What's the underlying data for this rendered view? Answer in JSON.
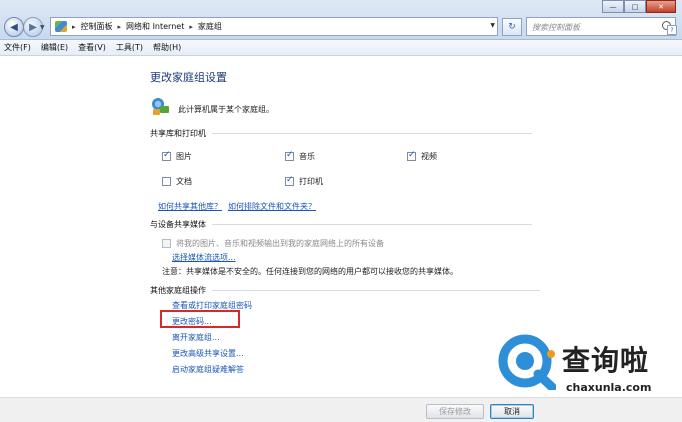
{
  "address": {
    "crumbs": [
      "控制面板",
      "网络和 Internet",
      "家庭组"
    ],
    "search_placeholder": "搜索控制面板"
  },
  "window": {
    "minimize": "—",
    "maximize": "□",
    "close": "✕"
  },
  "menubar": [
    "文件(F)",
    "编辑(E)",
    "查看(V)",
    "工具(T)",
    "帮助(H)"
  ],
  "page": {
    "title": "更改家庭组设置",
    "status": "此计算机属于某个家庭组。"
  },
  "share": {
    "heading": "共享库和打印机",
    "items": [
      {
        "label": "图片",
        "checked": true
      },
      {
        "label": "音乐",
        "checked": true
      },
      {
        "label": "视频",
        "checked": true
      },
      {
        "label": "文档",
        "checked": false
      },
      {
        "label": "打印机",
        "checked": true
      }
    ],
    "link_other_libs": "如何共享其他库？",
    "link_exclude": "如何排除文件和文件夹？"
  },
  "media": {
    "heading": "与设备共享媒体",
    "stream_label": "将我的图片、音乐和视频输出到我的家庭网络上的所有设备",
    "stream_options_link": "选择媒体流选项...",
    "note": "注意：共享媒体是不安全的。任何连接到您的网络的用户都可以接收您的共享媒体。"
  },
  "other": {
    "heading": "其他家庭组操作",
    "actions": [
      "查看或打印家庭组密码",
      "更改密码...",
      "离开家庭组...",
      "更改高级共享设置...",
      "启动家庭组疑难解答"
    ]
  },
  "buttons": {
    "save": "保存修改",
    "cancel": "取消"
  },
  "watermark": {
    "cn": "查询啦",
    "en": "chaxunla.com"
  }
}
